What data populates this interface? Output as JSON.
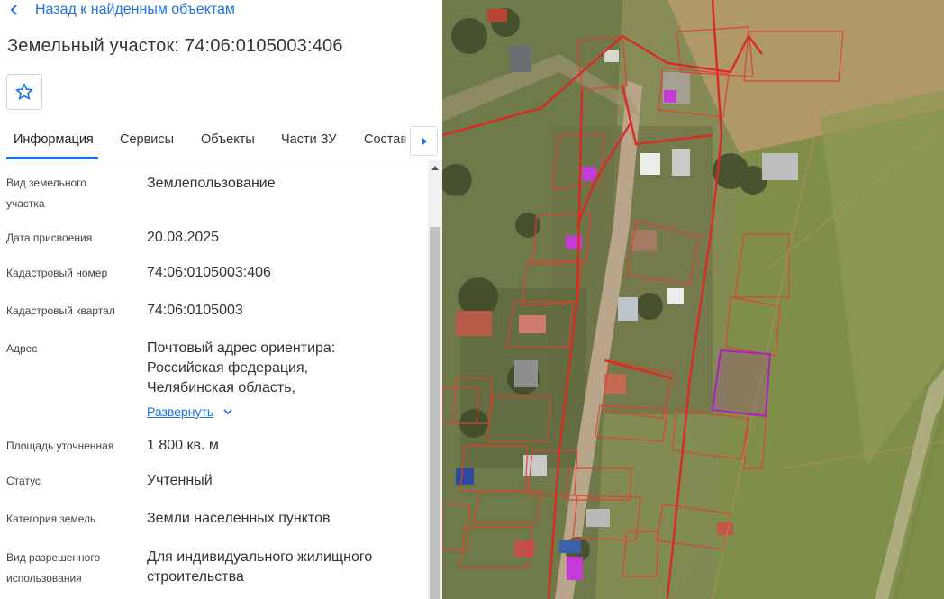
{
  "nav": {
    "back_label": "Назад к найденным объектам"
  },
  "object": {
    "title": "Земельный участок: 74:06:0105003:406"
  },
  "favorite": {
    "icon": "star-outline-icon"
  },
  "tabs": [
    {
      "label": "Информация",
      "active": true
    },
    {
      "label": "Сервисы",
      "active": false
    },
    {
      "label": "Объекты",
      "active": false
    },
    {
      "label": "Части ЗУ",
      "active": false
    },
    {
      "label": "Состав",
      "active": false
    }
  ],
  "details": {
    "land_type": {
      "label_l1": "Вид земельного",
      "label_l2": "участка",
      "value": "Землепользование"
    },
    "assign_date": {
      "label": "Дата присвоения",
      "value": "20.08.2025"
    },
    "cadastral_number": {
      "label": "Кадастровый номер",
      "value": "74:06:0105003:406"
    },
    "cadastral_quarter": {
      "label": "Кадастровый квартал",
      "value": "74:06:0105003"
    },
    "address": {
      "label": "Адрес",
      "line1": "Почтовый адрес ориентира:",
      "line2": "Российская федерация,",
      "line3": "Челябинская область,",
      "expand_label": "Развернуть"
    },
    "area": {
      "label": "Площадь уточненная",
      "value": "1 800 кв. м"
    },
    "status": {
      "label": "Статус",
      "value": "Учтенный"
    },
    "land_category": {
      "label": "Категория земель",
      "value": "Земли населенных пунктов"
    },
    "permitted_use": {
      "label_l1": "Вид разрешенного",
      "label_l2": "использования",
      "value_l1": "Для индивидуального жилищного",
      "value_l2": "строительства"
    }
  },
  "colors": {
    "accent": "#1a73e8",
    "parcel_border": "#e0402f",
    "selected_parcel": "#b01fbf",
    "building_marker": "#c43bd6"
  }
}
